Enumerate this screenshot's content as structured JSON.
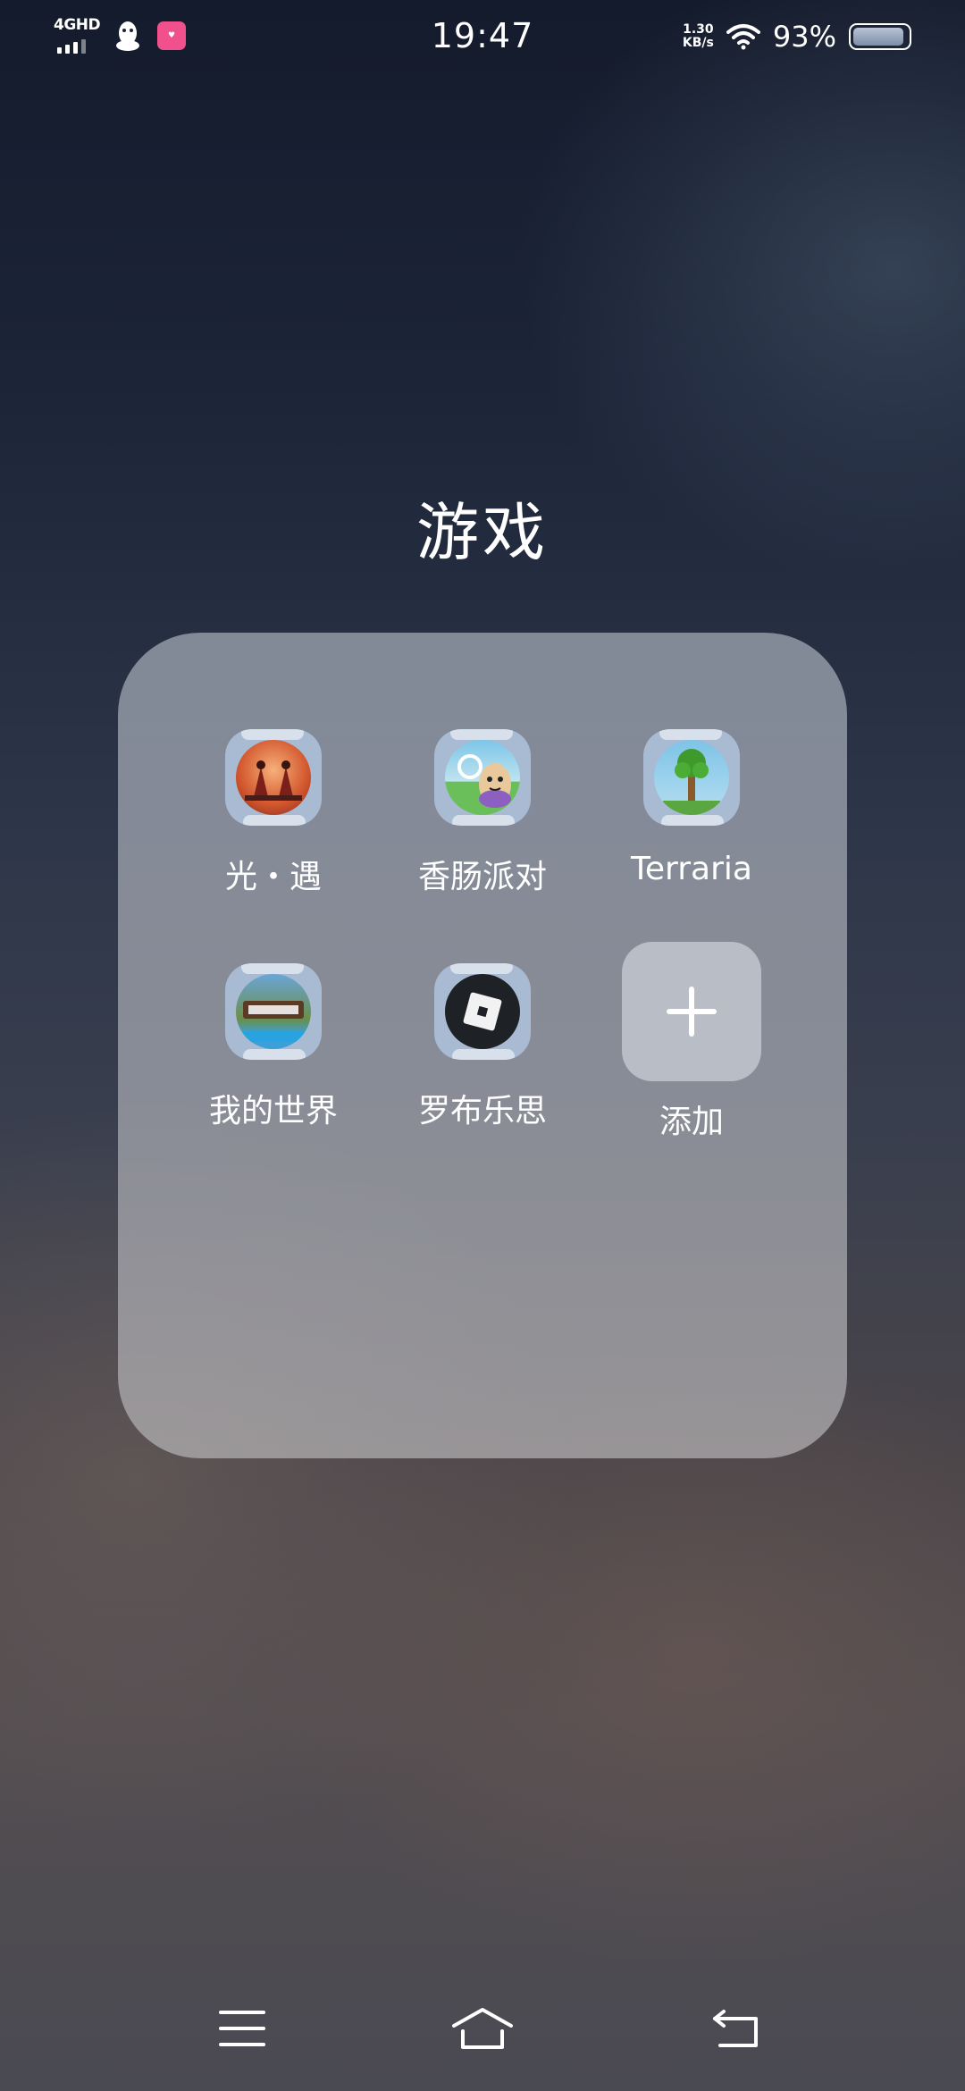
{
  "status_bar": {
    "network": "4GHD",
    "time": "19:47",
    "speed_value": "1.30",
    "speed_unit": "KB/s",
    "battery_percent": "93%",
    "battery_level": 0.93,
    "notification_icons": [
      "qq-icon",
      "pink-app-icon"
    ]
  },
  "folder": {
    "title": "游戏",
    "apps": [
      {
        "name": "光・遇",
        "icon": "sky-game-icon"
      },
      {
        "name": "香肠派对",
        "icon": "sausage-party-icon"
      },
      {
        "name": "Terraria",
        "icon": "terraria-icon"
      },
      {
        "name": "我的世界",
        "icon": "minecraft-icon"
      },
      {
        "name": "罗布乐思",
        "icon": "roblox-icon"
      }
    ],
    "add_label": "添加"
  },
  "nav_bar": {
    "buttons": [
      "menu-icon",
      "home-icon",
      "back-icon"
    ]
  },
  "colors": {
    "folder_bg": "#a5acb8",
    "icon_frame": "#a9bbd2",
    "pink_app": "#f0508c"
  }
}
